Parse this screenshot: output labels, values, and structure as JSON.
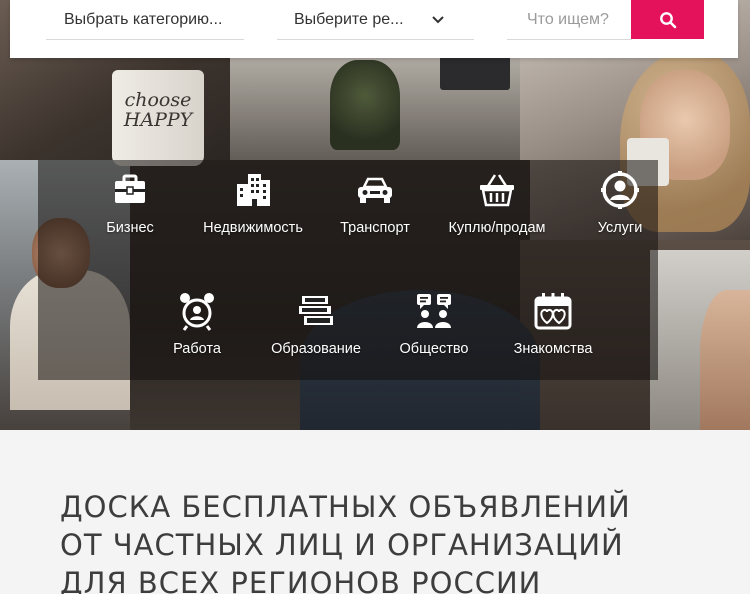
{
  "search": {
    "category_select": "Выбрать категорию...",
    "region_select": "Выберите ре...",
    "query_placeholder": "Что ищем?",
    "search_button_icon": "search-icon",
    "accent_color": "#e3125a"
  },
  "hero": {
    "mug_text_line1": "choose",
    "mug_text_line2": "HAPPY"
  },
  "categories": [
    {
      "label": "Бизнес",
      "icon": "briefcase-icon"
    },
    {
      "label": "Недвижимость",
      "icon": "buildings-icon"
    },
    {
      "label": "Транспорт",
      "icon": "car-icon"
    },
    {
      "label": "Куплю/продам",
      "icon": "basket-icon"
    },
    {
      "label": "Услуги",
      "icon": "service-person-icon"
    },
    {
      "label": "Работа",
      "icon": "alarm-worker-icon"
    },
    {
      "label": "Образование",
      "icon": "books-icon"
    },
    {
      "label": "Общество",
      "icon": "people-chat-icon"
    },
    {
      "label": "Знакомства",
      "icon": "calendar-hearts-icon"
    }
  ],
  "headline": {
    "line1": "ДОСКА БЕСПЛАТНЫХ ОБЪЯВЛЕНИЙ",
    "line2": "ОТ ЧАСТНЫХ ЛИЦ И ОРГАНИЗАЦИЙ",
    "line3": "ДЛЯ ВСЕХ РЕГИОНОВ РОССИИ"
  }
}
